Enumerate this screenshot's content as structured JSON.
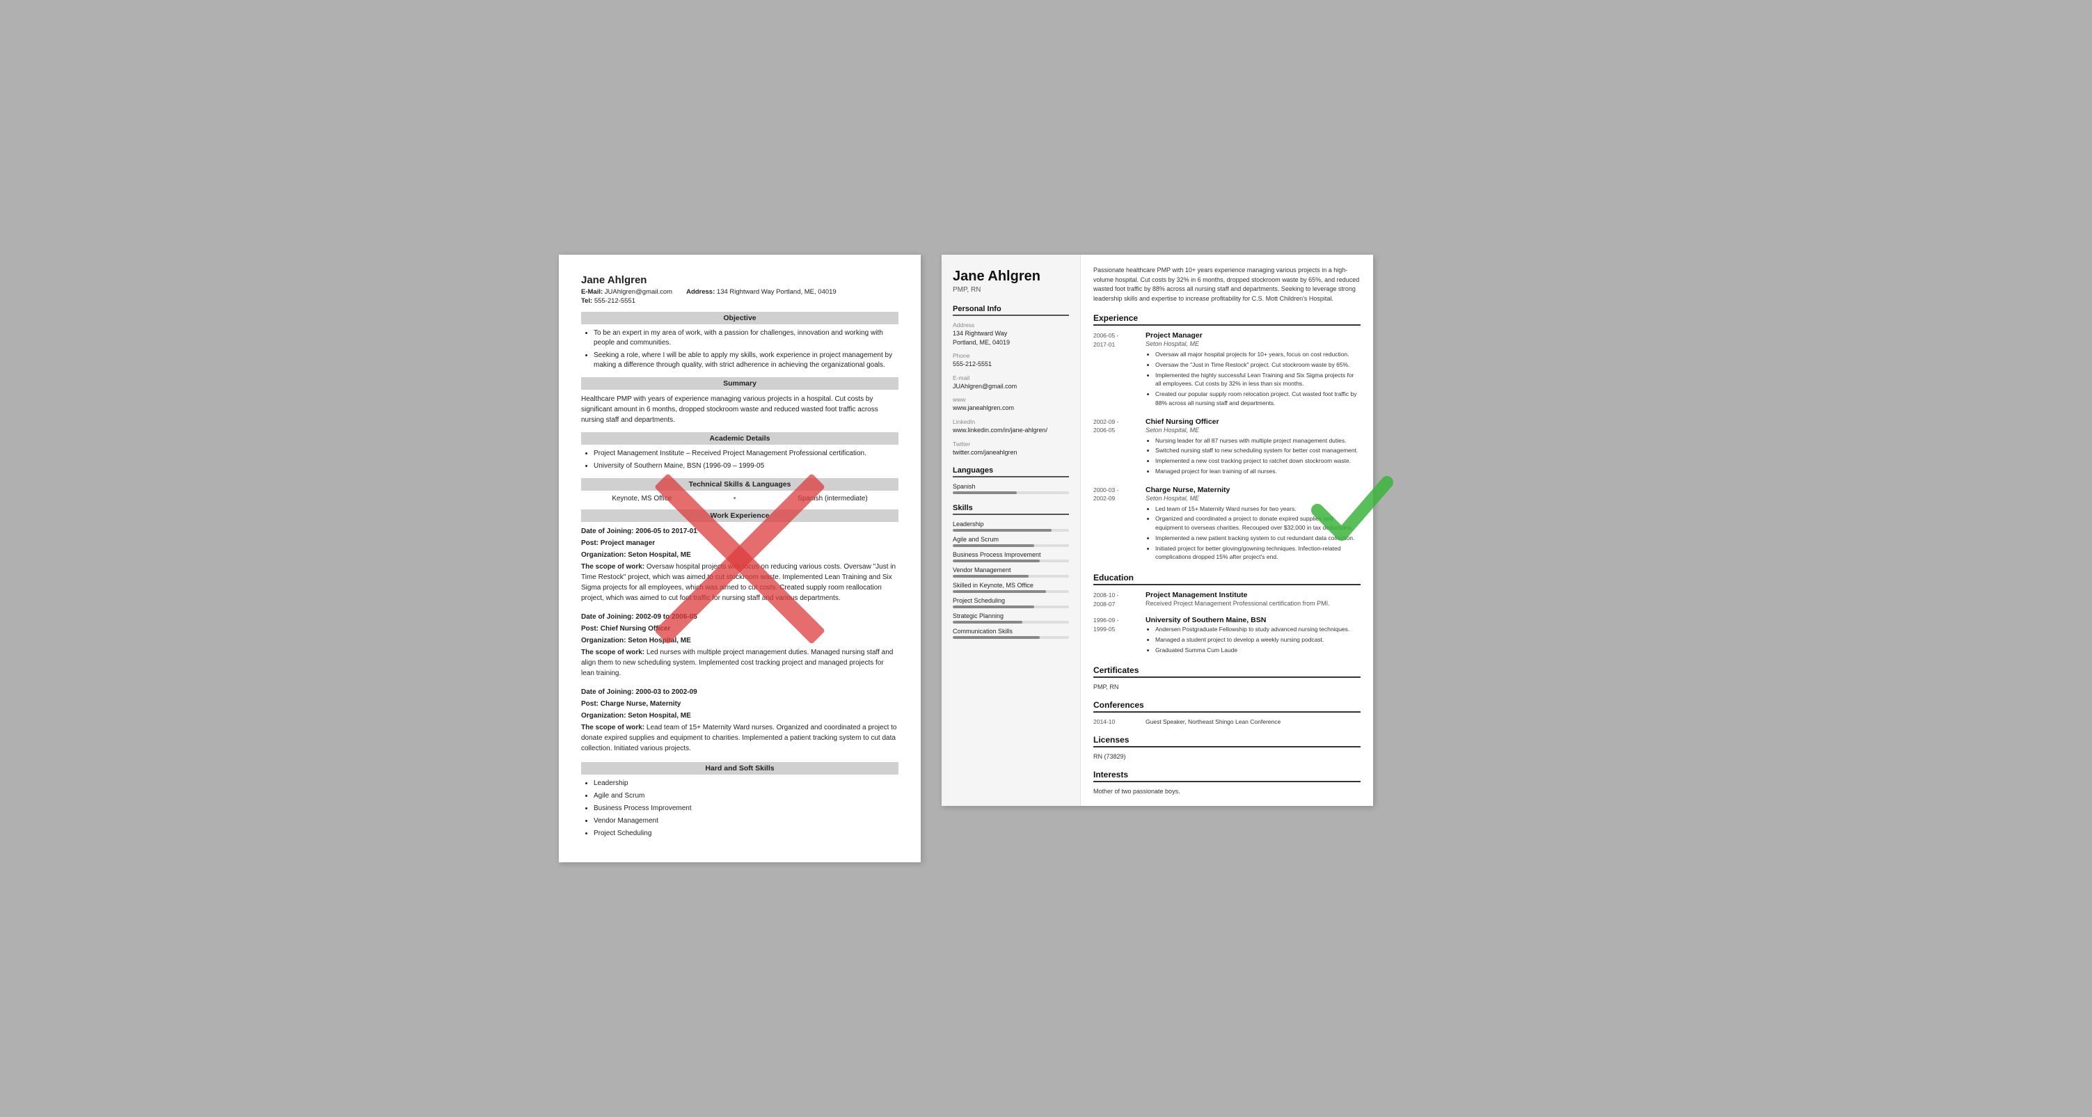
{
  "left_resume": {
    "name": "Jane Ahlgren",
    "email_label": "E-Mail:",
    "email": "JUAhlgren@gmail.com",
    "address_label": "Address:",
    "address": "134 Rightward Way Portland, ME, 04019",
    "tel_label": "Tel:",
    "tel": "555-212-5551",
    "sections": {
      "objective": {
        "title": "Objective",
        "bullets": [
          "To be an expert in my area of work, with a passion for challenges, innovation and working with people and communities.",
          "Seeking a role, where I will be able to apply my skills, work experience in project management by making a difference through quality, with strict adherence in achieving the organizational goals."
        ]
      },
      "summary": {
        "title": "Summary",
        "text": "Healthcare PMP with years of experience managing various projects in a hospital. Cut costs by significant amount in 6 months, dropped stockroom waste and reduced wasted foot traffic across nursing staff and departments."
      },
      "academic": {
        "title": "Academic Details",
        "bullets": [
          "Project Management Institute – Received Project Management Professional certification.",
          "University of Southern Maine, BSN (1996-09 – 1999-05"
        ]
      },
      "technical": {
        "title": "Technical Skills & Languages",
        "skills": [
          "Keynote, MS Office"
        ],
        "languages": [
          "Spanish (intermediate)"
        ]
      },
      "work": {
        "title": "Work Experience",
        "entries": [
          {
            "dates": "Date of Joining: 2006-05 to 2017-01",
            "post": "Post: Project manager",
            "org": "Organization: Seton Hospital, ME",
            "scope": "The scope of work: Oversaw hospital projects with focus on reducing various costs. Oversaw \"Just in Time Restock\" project, which was aimed to cut stockroom waste. Implemented Lean Training and Six Sigma projects for all employees, which was aimed to cut costs. Created supply room reallocation project, which was aimed to cut foot traffic for nursing staff and various departments."
          },
          {
            "dates": "Date of Joining: 2002-09 to 2006-05",
            "post": "Post: Chief Nursing Officer",
            "org": "Organization: Seton Hospital, ME",
            "scope": "The scope of work: Led nurses with multiple project management duties. Managed nursing staff and align them to new scheduling system. Implemented cost tracking project and managed projects for lean training."
          },
          {
            "dates": "Date of Joining: 2000-03 to 2002-09",
            "post": "Post: Charge Nurse, Maternity",
            "org": "Organization: Seton Hospital, ME",
            "scope": "The scope of work: Lead team of 15+ Maternity Ward nurses. Organized and coordinated a project to donate expired supplies and equipment to charities. Implemented a patient tracking system to cut data collection. Initiated various projects."
          }
        ]
      },
      "hard_soft": {
        "title": "Hard and Soft Skills",
        "skills": [
          "Leadership",
          "Agile and Scrum",
          "Business Process Improvement",
          "Vendor Management",
          "Project Scheduling"
        ]
      }
    }
  },
  "right_resume": {
    "name": "Jane Ahlgren",
    "credential": "PMP, RN",
    "summary": "Passionate healthcare PMP with 10+ years experience managing various projects in a high-volume hospital. Cut costs by 32% in 6 months, dropped stockroom waste by 65%, and reduced wasted foot traffic by 88% across all nursing staff and departments. Seeking to leverage strong leadership skills and expertise to increase profitability for C.S. Mott Children's Hospital.",
    "personal_info": {
      "section_title": "Personal Info",
      "address_label": "Address",
      "address": "134 Rightward Way\nPortland, ME, 04019",
      "phone_label": "Phone",
      "phone": "555-212-5551",
      "email_label": "E-mail",
      "email": "JUAhlgren@gmail.com",
      "www_label": "www",
      "www": "www.janeahlgren.com",
      "linkedin_label": "LinkedIn",
      "linkedin": "www.linkedin.com/in/jane-ahlgren/",
      "twitter_label": "Twitter",
      "twitter": "twitter.com/janeahlgren"
    },
    "languages": {
      "section_title": "Languages",
      "items": [
        {
          "name": "Spanish",
          "level": 55
        }
      ]
    },
    "skills": {
      "section_title": "Skills",
      "items": [
        {
          "name": "Leadership",
          "level": 85
        },
        {
          "name": "Agile and Scrum",
          "level": 70
        },
        {
          "name": "Business Process Improvement",
          "level": 75
        },
        {
          "name": "Vendor Management",
          "level": 65
        },
        {
          "name": "Skilled in Keynote, MS Office",
          "level": 80
        },
        {
          "name": "Project Scheduling",
          "level": 70
        },
        {
          "name": "Strategic Planning",
          "level": 60
        },
        {
          "name": "Communication Skills",
          "level": 75
        }
      ]
    },
    "experience": {
      "section_title": "Experience",
      "entries": [
        {
          "dates": "2006-05 -\n2017-01",
          "title": "Project Manager",
          "org": "Seton Hospital, ME",
          "bullets": [
            "Oversaw all major hospital projects for 10+ years, focus on cost reduction.",
            "Oversaw the \"Just in Time Restock\" project. Cut stockroom waste by 65%.",
            "Implemented the highly successful Lean Training and Six Sigma projects for all employees. Cut costs by 32% in less than six months.",
            "Created our popular supply room relocation project. Cut wasted foot traffic by 88% across all nursing staff and departments."
          ]
        },
        {
          "dates": "2002-09 -\n2006-05",
          "title": "Chief Nursing Officer",
          "org": "Seton Hospital, ME",
          "bullets": [
            "Nursing leader for all 87 nurses with multiple project management duties.",
            "Switched nursing staff to new scheduling system for better cost management.",
            "Implemented a new cost tracking project to ratchet down stockroom waste.",
            "Managed project for lean training of all nurses."
          ]
        },
        {
          "dates": "2000-03 -\n2002-09",
          "title": "Charge Nurse, Maternity",
          "org": "Seton Hospital, ME",
          "bullets": [
            "Led team of 15+ Maternity Ward nurses for two years.",
            "Organized and coordinated a project to donate expired supplies and equipment to overseas charities. Recouped over $32,000 in tax deductions.",
            "Implemented a new patient tracking system to cut redundant data collection.",
            "Initiated project for better gloving/gowning techniques. Infection-related complications dropped 15% after project's end."
          ]
        }
      ]
    },
    "education": {
      "section_title": "Education",
      "entries": [
        {
          "dates": "2008-10 -\n2008-07",
          "title": "Project Management Institute",
          "org": "Received Project Management Professional certification from PMI."
        },
        {
          "dates": "1996-09 -\n1999-05",
          "title": "University of Southern Maine, BSN",
          "bullets": [
            "Andersen Postgraduate Fellowship to study advanced nursing techniques.",
            "Managed a student project to develop a weekly nursing podcast.",
            "Graduated Summa Cum Laude"
          ]
        }
      ]
    },
    "certificates": {
      "section_title": "Certificates",
      "items": [
        "PMP, RN"
      ]
    },
    "conferences": {
      "section_title": "Conferences",
      "entries": [
        {
          "date": "2014-10",
          "text": "Guest Speaker, Northeast Shingo Lean Conference"
        }
      ]
    },
    "licenses": {
      "section_title": "Licenses",
      "items": [
        "RN (73829)"
      ]
    },
    "interests": {
      "section_title": "Interests",
      "items": [
        "Mother of two passionate boys."
      ]
    }
  }
}
